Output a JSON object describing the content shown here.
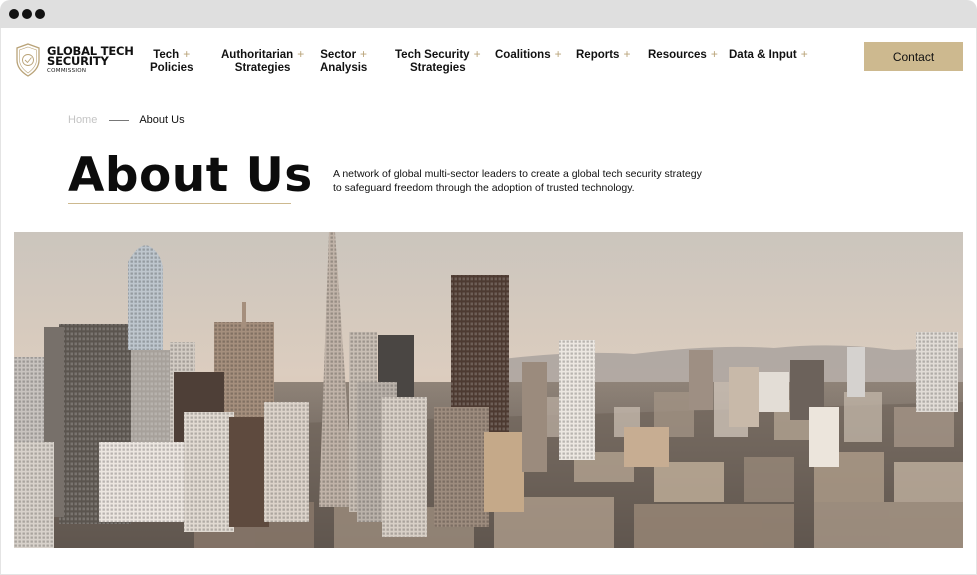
{
  "brand": {
    "name_line1": "GLOBAL TECH",
    "name_line2": "SECURITY",
    "name_line3": "COMMISSION"
  },
  "nav": [
    {
      "line1": "Tech",
      "line2": "Policies",
      "plus": "+"
    },
    {
      "line1": "Authoritarian",
      "line2": "Strategies",
      "plus": "+"
    },
    {
      "line1": "Sector",
      "line2": "Analysis",
      "plus": "+"
    },
    {
      "line1": "Tech Security",
      "line2": "Strategies",
      "plus": "+"
    },
    {
      "line1": "Coalitions",
      "line2": "",
      "plus": "+"
    },
    {
      "line1": "Reports",
      "line2": "",
      "plus": "+"
    },
    {
      "line1": "Resources",
      "line2": "",
      "plus": "+"
    },
    {
      "line1": "Data & Input",
      "line2": "",
      "plus": "+"
    }
  ],
  "contact_label": "Contact",
  "breadcrumb": {
    "home": "Home",
    "current": "About Us"
  },
  "page": {
    "title": "About Us",
    "intro": "A network of global multi-sector leaders to create a global tech security strategy to safeguard freedom through the adoption of trusted technology."
  },
  "colors": {
    "accent": "#cdb98f",
    "plus": "#b9a378",
    "text": "#111111"
  },
  "icons": {
    "logo": "shield-logo-icon",
    "window_controls": "window-dot-icon"
  }
}
